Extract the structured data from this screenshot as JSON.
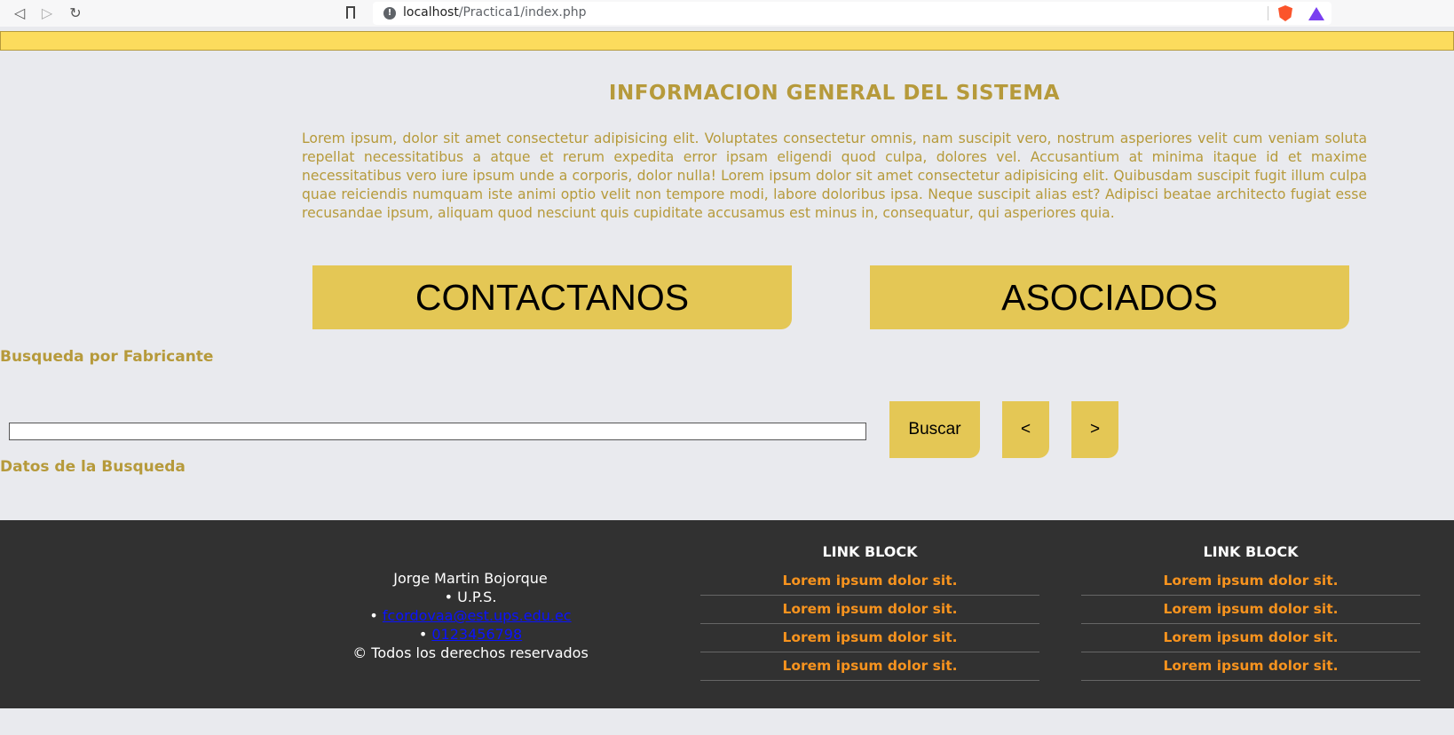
{
  "browser": {
    "url_host": "localhost",
    "url_path": "/Practica1/index.php",
    "back_icon": "back-arrow-icon",
    "forward_icon": "forward-arrow-icon",
    "reload_icon": "reload-icon"
  },
  "main": {
    "heading": "INFORMACION GENERAL DEL SISTEMA",
    "paragraph": "Lorem ipsum, dolor sit amet consectetur adipisicing elit. Voluptates consectetur omnis, nam suscipit vero, nostrum asperiores velit cum veniam soluta repellat necessitatibus a atque et rerum expedita error ipsam eligendi quod culpa, dolores vel. Accusantium at minima itaque id et maxime necessitatibus vero iure ipsum unde a corporis, dolor nulla! Lorem ipsum dolor sit amet consectetur adipisicing elit. Quibusdam suscipit fugit illum culpa quae reiciendis numquam iste animi optio velit non tempore modi, labore doloribus ipsa. Neque suscipit alias est? Adipisci beatae architecto fugiat esse recusandae ipsum, aliquam quod nesciunt quis cupiditate accusamus est minus in, consequatur, qui asperiores quia.",
    "contact_button": "CONTACTANOS",
    "associates_button": "ASOCIADOS"
  },
  "search": {
    "label": "Busqueda por Fabricante",
    "input_value": "",
    "search_button": "Buscar",
    "prev_button": "<",
    "next_button": ">",
    "results_label": "Datos de la Busqueda"
  },
  "footer": {
    "name": "Jorge Martin Bojorque",
    "org": "• U.P.S.",
    "email_prefix": "• ",
    "email": "fcordovaa@est.ups.edu.ec",
    "phone_prefix": "• ",
    "phone": "0123456798",
    "copyright": "© Todos los derechos reservados",
    "link_blocks": [
      {
        "title": "LINK BLOCK",
        "links": [
          "Lorem ipsum dolor sit.",
          "Lorem ipsum dolor sit.",
          "Lorem ipsum dolor sit.",
          "Lorem ipsum dolor sit."
        ]
      },
      {
        "title": "LINK BLOCK",
        "links": [
          "Lorem ipsum dolor sit.",
          "Lorem ipsum dolor sit.",
          "Lorem ipsum dolor sit.",
          "Lorem ipsum dolor sit."
        ]
      }
    ]
  },
  "colors": {
    "gold": "#b69a3b",
    "button": "#e4c755",
    "banner": "#fcdc5d",
    "footer_bg": "#313131",
    "footer_link": "#f7931e"
  }
}
